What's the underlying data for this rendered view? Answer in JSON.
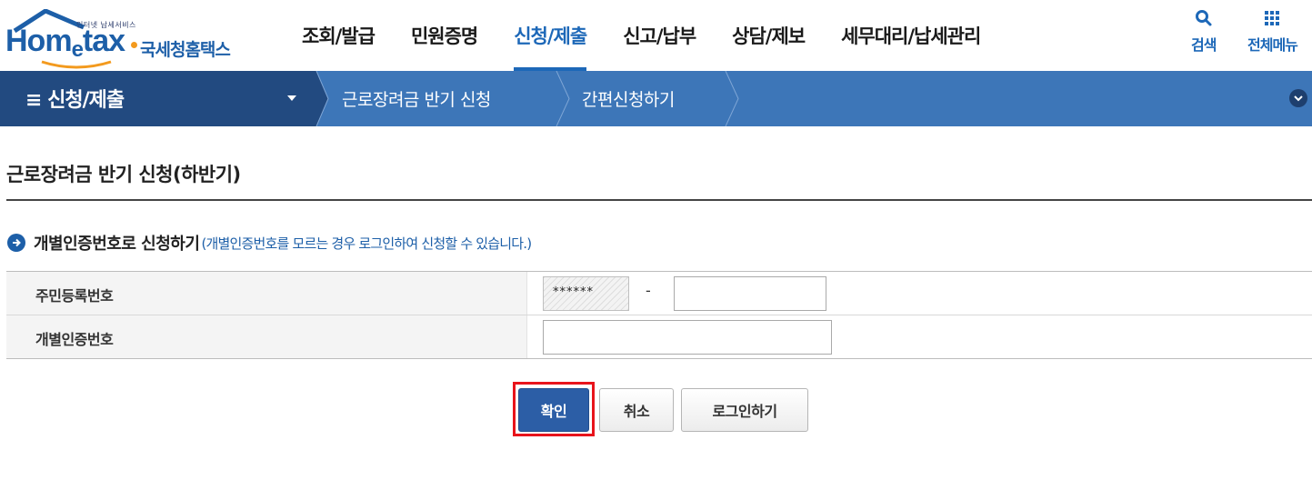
{
  "header": {
    "logo": {
      "tagline": "인터넷 납세서비스",
      "brand_prefix": "Hom",
      "brand_e": "e",
      "brand_suffix": "tax",
      "brand_korean": "국세청홈택스"
    },
    "nav": [
      {
        "label": "조회/발급",
        "active": false
      },
      {
        "label": "민원증명",
        "active": false
      },
      {
        "label": "신청/제출",
        "active": true
      },
      {
        "label": "신고/납부",
        "active": false
      },
      {
        "label": "상담/제보",
        "active": false
      },
      {
        "label": "세무대리/납세관리",
        "active": false
      }
    ],
    "search_label": "검색",
    "allmenu_label": "전체메뉴"
  },
  "location": {
    "menu_title": "≡ 신청/제출",
    "crumbs": [
      "근로장려금 반기 신청",
      "간편신청하기"
    ]
  },
  "page": {
    "title": "근로장려금 반기 신청(하반기)",
    "section_heading": "개별인증번호로 신청하기",
    "section_note": "(개별인증번호를 모르는 경우 로그인하여 신청할 수 있습니다.)"
  },
  "form": {
    "rows": [
      {
        "label": "주민등록번호"
      },
      {
        "label": "개별인증번호"
      }
    ],
    "jumin_masked": "******",
    "jumin_dash": "-",
    "jumin_back_value": "",
    "cert_value": ""
  },
  "buttons": {
    "confirm": "확인",
    "cancel": "취소",
    "login": "로그인하기"
  },
  "colors": {
    "brand_blue": "#1d5fa8",
    "active_nav": "#1d68b8",
    "locbar": "#3d76b8",
    "locbar_dark": "#224a80",
    "highlight_red": "#e8141b"
  }
}
